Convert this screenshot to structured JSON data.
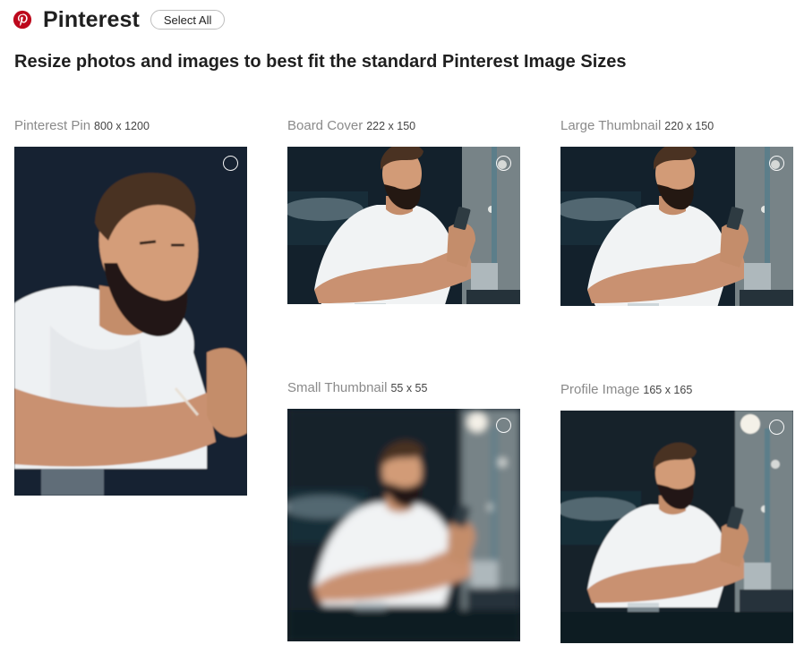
{
  "header": {
    "brand": "Pinterest",
    "select_all_label": "Select All",
    "logo_icon": "pinterest-logo-icon",
    "brand_color": "#bd081c"
  },
  "subtitle": "Resize photos and images to best fit the standard Pinterest Image Sizes",
  "cards": [
    {
      "name": "Pinterest Pin",
      "size": "800 x 1200"
    },
    {
      "name": "Board Cover",
      "size": "222 x 150"
    },
    {
      "name": "Large Thumbnail",
      "size": "220 x 150"
    },
    {
      "name": "Small Thumbnail",
      "size": "55 x 55"
    },
    {
      "name": "Profile Image",
      "size": "165 x 165"
    }
  ]
}
